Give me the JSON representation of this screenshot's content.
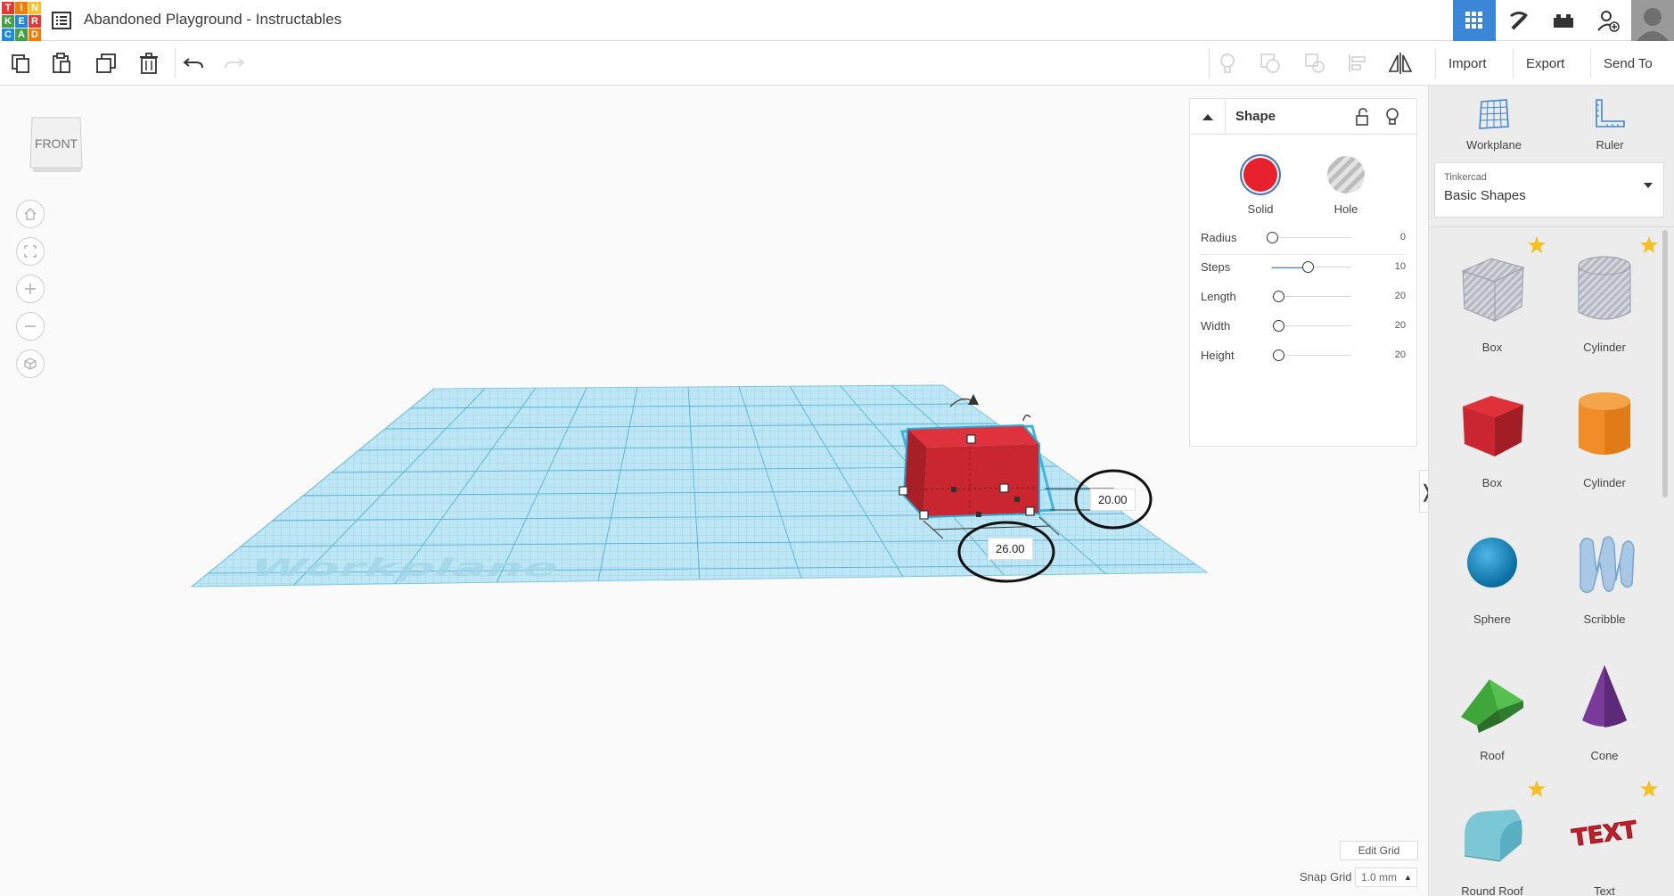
{
  "topbar": {
    "logo_letters": [
      "T",
      "I",
      "N",
      "K",
      "E",
      "R",
      "C",
      "A",
      "D"
    ],
    "logo_colors": [
      "#e53935",
      "#f57c00",
      "#fbc02d",
      "#43a047",
      "#1e88e5",
      "#e53935",
      "#1e88e5",
      "#43a047",
      "#f57c00"
    ],
    "document_title": "Abandoned Playground - Instructables",
    "menu_icon": "list-icon",
    "view_icons": [
      "grid-3d-icon",
      "pickaxe-icon",
      "bricks-icon",
      "add-user-icon"
    ],
    "accent": "#3b86d6"
  },
  "toolbar": {
    "tools": [
      "copy-icon",
      "paste-icon",
      "duplicate-icon",
      "delete-icon",
      "undo-icon",
      "redo-icon"
    ],
    "right_tools": [
      "bulb-icon",
      "group-icon",
      "ungroup-icon",
      "align-icon",
      "mirror-icon"
    ],
    "import_label": "Import",
    "export_label": "Export",
    "sendto_label": "Send To"
  },
  "canvas": {
    "viewcube_label": "FRONT",
    "workplane_label": "Workplane",
    "dimension_width": "20.00",
    "dimension_length": "26.00",
    "edit_grid_label": "Edit Grid",
    "snap_grid_label": "Snap Grid",
    "snap_grid_value": "1.0 mm"
  },
  "inspector": {
    "title": "Shape",
    "solid_label": "Solid",
    "hole_label": "Hole",
    "solid_color": "#e8212e",
    "params": [
      {
        "label": "Radius",
        "value": "0",
        "fraction": 0.0
      },
      {
        "label": "Steps",
        "value": "10",
        "fraction": 0.45
      },
      {
        "label": "Length",
        "value": "20",
        "fraction": 0.08
      },
      {
        "label": "Width",
        "value": "20",
        "fraction": 0.08
      },
      {
        "label": "Height",
        "value": "20",
        "fraction": 0.08
      }
    ]
  },
  "right_panel": {
    "workplane_label": "Workplane",
    "ruler_label": "Ruler",
    "library_category": "Tinkercad",
    "library_name": "Basic Shapes",
    "shapes": [
      {
        "label": "Box",
        "kind": "box-hole",
        "favorite": true
      },
      {
        "label": "Cylinder",
        "kind": "cylinder-hole",
        "favorite": true
      },
      {
        "label": "Box",
        "kind": "box",
        "favorite": false
      },
      {
        "label": "Cylinder",
        "kind": "cylinder",
        "favorite": false
      },
      {
        "label": "Sphere",
        "kind": "sphere",
        "favorite": false
      },
      {
        "label": "Scribble",
        "kind": "scribble",
        "favorite": false
      },
      {
        "label": "Roof",
        "kind": "roof",
        "favorite": false
      },
      {
        "label": "Cone",
        "kind": "cone",
        "favorite": false
      },
      {
        "label": "Round Roof",
        "kind": "round-roof",
        "favorite": true
      },
      {
        "label": "Text",
        "kind": "text",
        "favorite": true
      }
    ],
    "text_shape_glyph": "TEXT"
  }
}
